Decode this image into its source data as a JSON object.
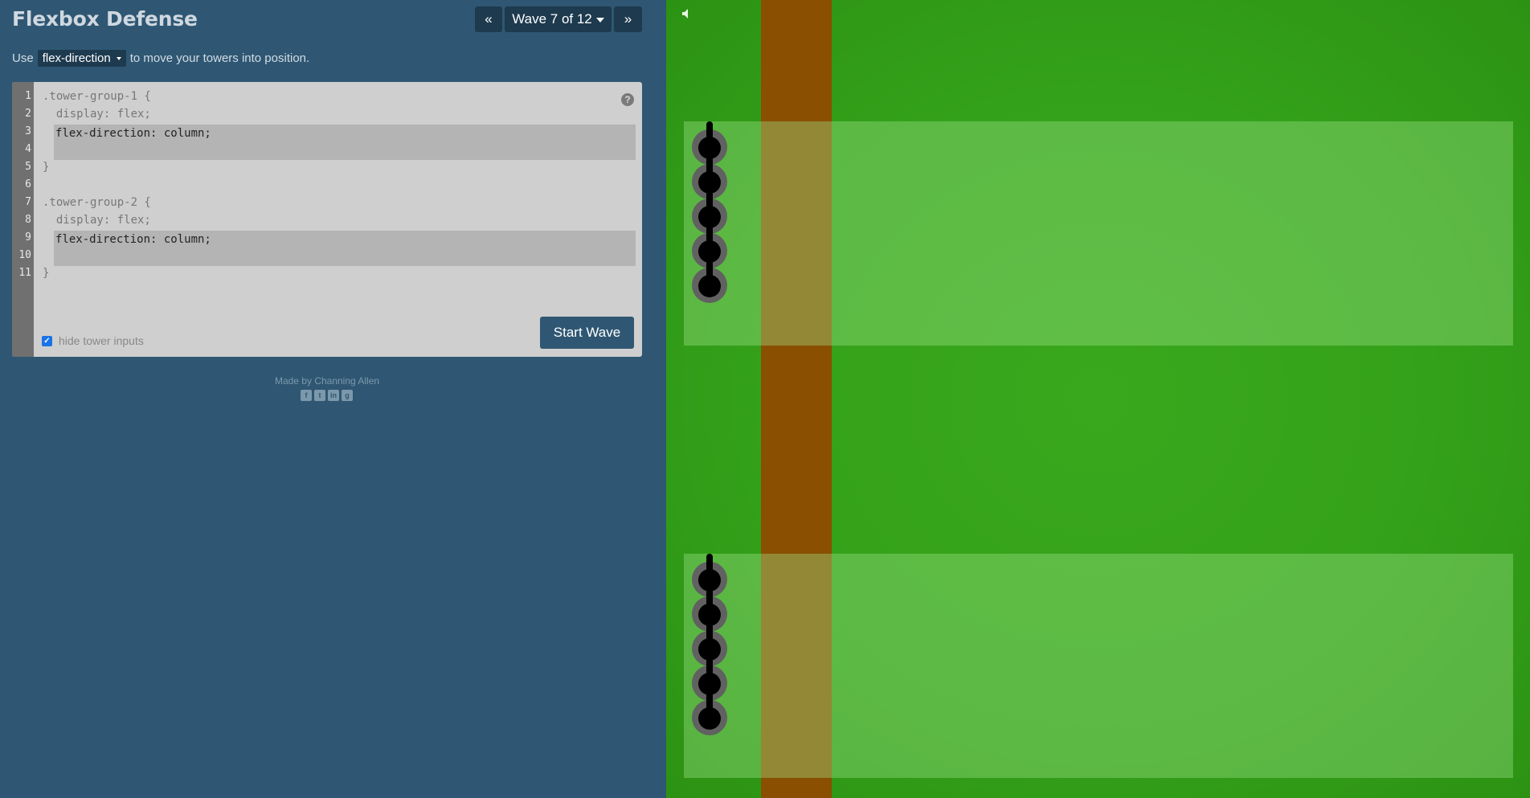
{
  "header": {
    "title": "Flexbox Defense",
    "prev_label": "«",
    "wave_label": "Wave 7 of 12",
    "next_label": "»"
  },
  "instruction": {
    "prefix": "Use",
    "property": "flex-direction",
    "suffix": "to move your towers into position."
  },
  "editor": {
    "line_numbers": [
      "1",
      "2",
      "3",
      "4",
      "5",
      "6",
      "7",
      "8",
      "9",
      "10",
      "11"
    ],
    "group1_selector": ".tower-group-1 {",
    "group1_display": "  display: flex;",
    "group1_input1": "flex-direction: column;",
    "group1_input2": "",
    "group1_close": "}",
    "group2_selector": ".tower-group-2 {",
    "group2_display": "  display: flex;",
    "group2_input1": "flex-direction: column;",
    "group2_input2": "",
    "group2_close": "}",
    "help_label": "?",
    "hide_inputs_label": "hide tower inputs",
    "hide_inputs_checked": true,
    "start_label": "Start Wave"
  },
  "footer": {
    "credit": "Made by Channing Allen",
    "social": [
      "facebook-icon",
      "twitter-icon",
      "linkedin-icon",
      "github-icon"
    ]
  },
  "board": {
    "tower_group_1_count": 5,
    "tower_group_2_count": 5,
    "colors": {
      "grass": "#34a11a",
      "path": "#8a4f00",
      "panel": "#2f5773",
      "button": "#1d3a4f"
    }
  }
}
